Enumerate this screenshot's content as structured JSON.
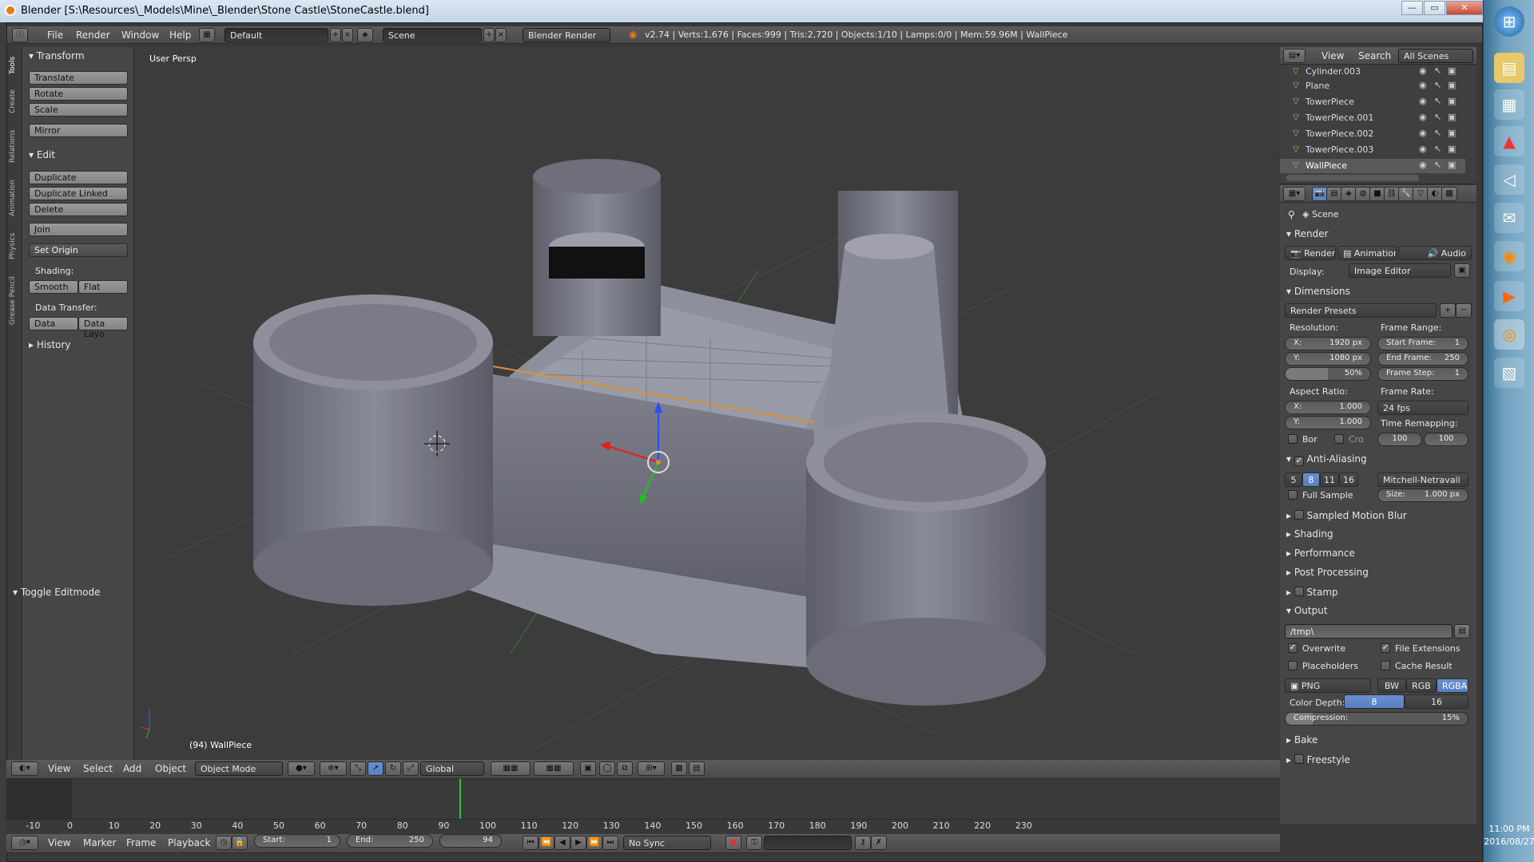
{
  "window": {
    "title": "Blender [S:\\Resources\\_Models\\Mine\\_Blender\\Stone Castle\\StoneCastle.blend]",
    "min_label": "—",
    "max_label": "▭",
    "close_label": "✕"
  },
  "top_header": {
    "menus": [
      "File",
      "Render",
      "Window",
      "Help"
    ],
    "layout": "Default",
    "scene": "Scene",
    "engine": "Blender Render",
    "stats": "v2.74 | Verts:1,676 | Faces:999 | Tris:2,720 | Objects:1/10 | Lamps:0/0 | Mem:59.96M | WallPiece"
  },
  "tool_tabs": [
    "Tools",
    "Create",
    "Relations",
    "Animation",
    "Physics",
    "Grease Pencil"
  ],
  "toolshelf": {
    "transform": {
      "title": "Transform",
      "buttons": [
        "Translate",
        "Rotate",
        "Scale",
        "Mirror"
      ]
    },
    "edit": {
      "title": "Edit",
      "buttons": [
        "Duplicate",
        "Duplicate Linked",
        "Delete",
        "Join"
      ],
      "set_origin": "Set Origin",
      "shading_label": "Shading:",
      "smooth": "Smooth",
      "flat": "Flat",
      "data_transfer_label": "Data Transfer:",
      "data": "Data",
      "data_layo": "Data Layo"
    },
    "history": "History",
    "toggle_editmode": "Toggle Editmode"
  },
  "viewport": {
    "view_name": "User Persp",
    "object_label": "(94) WallPiece"
  },
  "viewport_header": {
    "menus": [
      "View",
      "Select",
      "Add",
      "Object"
    ],
    "mode": "Object Mode",
    "orientation": "Global"
  },
  "outliner": {
    "menus": [
      "View",
      "Search"
    ],
    "display": "All Scenes",
    "items": [
      {
        "name": "Cylinder.003"
      },
      {
        "name": "Plane"
      },
      {
        "name": "TowerPiece"
      },
      {
        "name": "TowerPiece.001"
      },
      {
        "name": "TowerPiece.002"
      },
      {
        "name": "TowerPiece.003"
      },
      {
        "name": "WallPiece"
      }
    ]
  },
  "properties": {
    "scene_label": "Scene",
    "render_panel": "Render",
    "render_btn": "Render",
    "animation_btn": "Animation",
    "audio_btn": "Audio",
    "display_label": "Display:",
    "display_value": "Image Editor",
    "dimensions": "Dimensions",
    "render_presets": "Render Presets",
    "resolution_label": "Resolution:",
    "res_x": "X:",
    "res_x_val": "1920 px",
    "res_y": "Y:",
    "res_y_val": "1080 px",
    "res_pct": "50%",
    "frame_range_label": "Frame Range:",
    "start_frame": "Start Frame:",
    "start_frame_val": "1",
    "end_frame": "End Frame:",
    "end_frame_val": "250",
    "frame_step": "Frame Step:",
    "frame_step_val": "1",
    "aspect_label": "Aspect Ratio:",
    "asp_x": "X:",
    "asp_x_val": "1.000",
    "asp_y": "Y:",
    "asp_y_val": "1.000",
    "frame_rate_label": "Frame Rate:",
    "frame_rate": "24 fps",
    "time_remap_label": "Time Remapping:",
    "remap_old": "100",
    "remap_new": "100",
    "bor": "Bor",
    "cro": "Cro",
    "anti_aliasing": "Anti-Aliasing",
    "aa_samples": [
      "5",
      "8",
      "11",
      "16"
    ],
    "aa_filter": "Mitchell-Netravali",
    "full_sample": "Full Sample",
    "size_label": "Size:",
    "size_val": "1.000 px",
    "sampled_motion_blur": "Sampled Motion Blur",
    "shading": "Shading",
    "performance": "Performance",
    "post_processing": "Post Processing",
    "stamp": "Stamp",
    "output": "Output",
    "output_path": "/tmp\\",
    "overwrite": "Overwrite",
    "file_extensions": "File Extensions",
    "placeholders": "Placeholders",
    "cache_result": "Cache Result",
    "format": "PNG",
    "bw": "BW",
    "rgb": "RGB",
    "rgba": "RGBA",
    "color_depth_label": "Color Depth:",
    "depth_8": "8",
    "depth_16": "16",
    "compression_label": "Compression:",
    "compression_val": "15%",
    "bake": "Bake",
    "freestyle": "Freestyle"
  },
  "timeline": {
    "ruler": [
      "-10",
      "0",
      "10",
      "20",
      "30",
      "40",
      "50",
      "60",
      "70",
      "80",
      "90",
      "100",
      "110",
      "120",
      "130",
      "140",
      "150",
      "160",
      "170",
      "180",
      "190",
      "200",
      "210",
      "220",
      "230"
    ],
    "current_frame_marker": 94,
    "menus": [
      "View",
      "Marker",
      "Frame",
      "Playback"
    ],
    "start_label": "Start:",
    "start_val": "1",
    "end_label": "End:",
    "end_val": "250",
    "current": "94",
    "sync": "No Sync"
  },
  "taskbar": {
    "time": "11:00 PM",
    "date": "2016/08/27"
  }
}
